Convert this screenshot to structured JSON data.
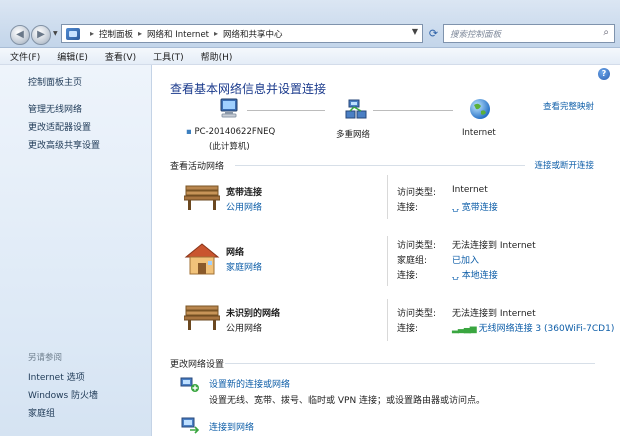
{
  "address": {
    "crumbs": [
      "控制面板",
      "网络和 Internet",
      "网络和共享中心"
    ],
    "search_placeholder": "搜索控制面板"
  },
  "menu": [
    "文件(F)",
    "编辑(E)",
    "查看(V)",
    "工具(T)",
    "帮助(H)"
  ],
  "sidebar": {
    "items": [
      "控制面板主页",
      "管理无线网络",
      "更改适配器设置",
      "更改高级共享设置"
    ],
    "see_also_title": "另请参阅",
    "see_also": [
      "Internet 选项",
      "Windows 防火墙",
      "家庭组"
    ]
  },
  "main": {
    "title": "查看基本网络信息并设置连接",
    "full_map_link": "查看完整映射",
    "map": {
      "computer_name": "PC-20140622FNEQ",
      "computer_sub": "(此计算机)",
      "network": "多重网络",
      "internet": "Internet"
    },
    "active_heading": "查看活动网络",
    "connect_link": "连接或断开连接",
    "networks": [
      {
        "name": "宽带连接",
        "type": "公用网络",
        "rows": [
          {
            "key": "访问类型:",
            "value": "Internet"
          },
          {
            "key": "连接:",
            "value": "宽带连接"
          }
        ]
      },
      {
        "name": "网络",
        "type": "家庭网络",
        "rows": [
          {
            "key": "访问类型:",
            "value": "无法连接到 Internet"
          },
          {
            "key": "家庭组:",
            "value": "已加入"
          },
          {
            "key": "连接:",
            "value": "本地连接"
          }
        ]
      },
      {
        "name": "未识别的网络",
        "type": "公用网络",
        "rows": [
          {
            "key": "访问类型:",
            "value": "无法连接到 Internet"
          },
          {
            "key": "连接:",
            "value": "无线网络连接 3 (360WiFi-7CD1)"
          }
        ]
      }
    ],
    "change_heading": "更改网络设置",
    "tasks": [
      {
        "link": "设置新的连接或网络",
        "desc": "设置无线、宽带、拨号、临时或 VPN 连接；或设置路由器或访问点。"
      },
      {
        "link": "连接到网络",
        "desc": ""
      }
    ]
  }
}
